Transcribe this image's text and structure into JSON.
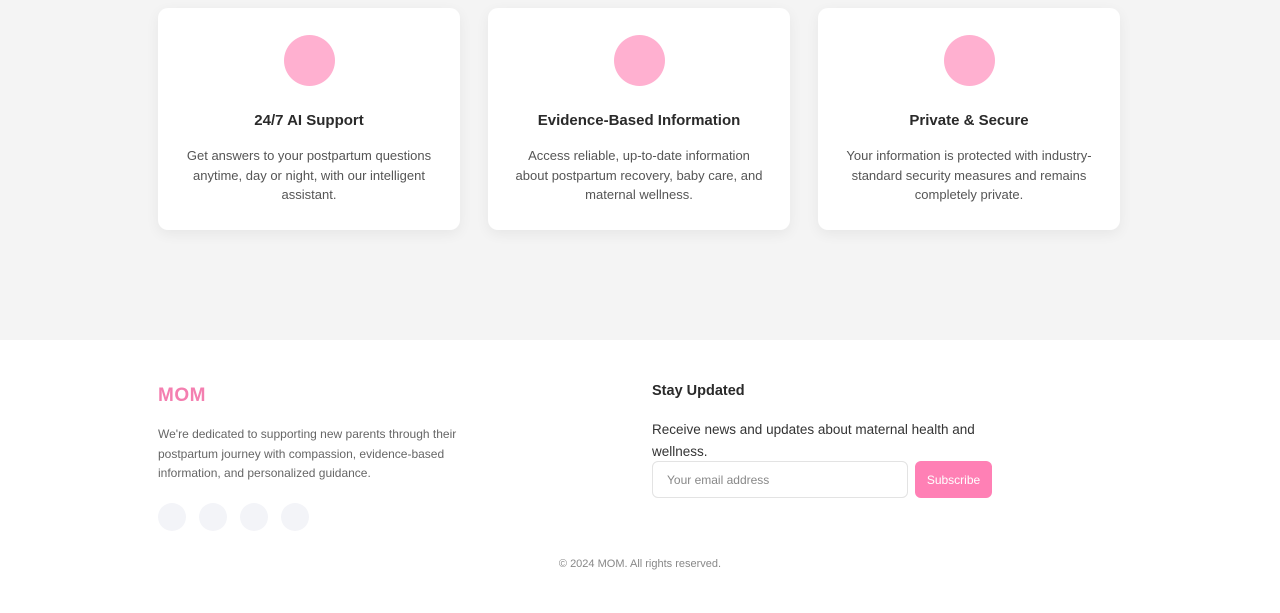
{
  "features": [
    {
      "title": "24/7 AI Support",
      "description": "Get answers to your postpartum questions anytime, day or night, with our intelligent assistant."
    },
    {
      "title": "Evidence-Based Information",
      "description": "Access reliable, up-to-date information about postpartum recovery, baby care, and maternal wellness."
    },
    {
      "title": "Private & Secure",
      "description": "Your information is protected with industry-standard security measures and remains completely private."
    }
  ],
  "footer": {
    "brand": "MOM",
    "about": "We're dedicated to supporting new parents through their postpartum journey with compassion, evidence-based information, and personalized guidance.",
    "newsletter": {
      "title": "Stay Updated",
      "text": "Receive news and updates about maternal health and wellness.",
      "email_placeholder": "Your email address",
      "email_value": "",
      "subscribe_label": "Subscribe"
    },
    "copyright": "© 2024 MOM. All rights reserved."
  },
  "colors": {
    "accent": "#ff80b5",
    "brand": "#f47fb0",
    "icon_circle": "#ffb0d0",
    "section_bg": "#f4f4f4"
  }
}
